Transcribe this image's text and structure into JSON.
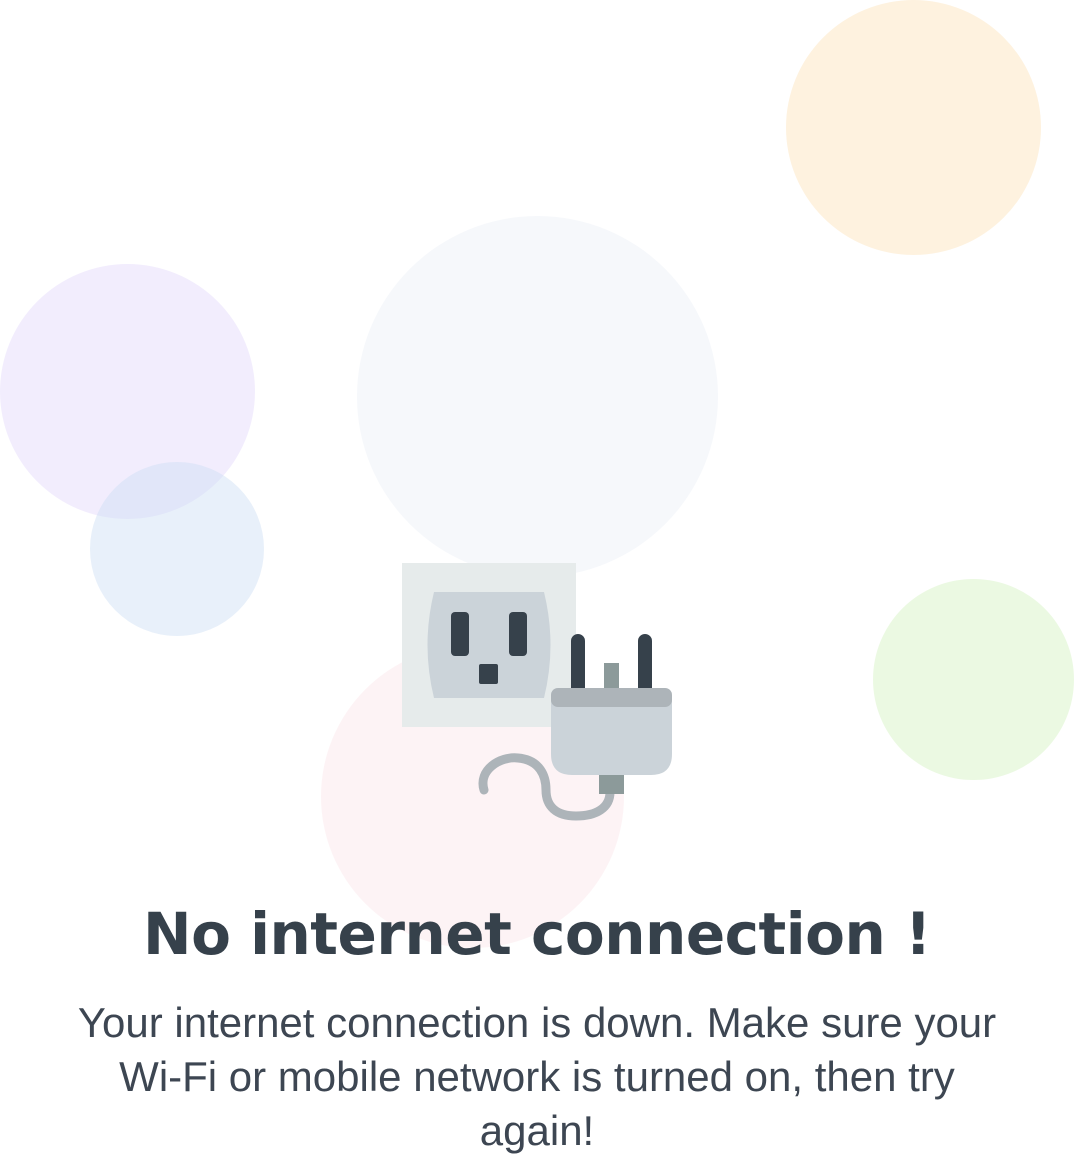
{
  "offline_screen": {
    "title": "No internet connection !",
    "message": "Your internet connection is down. Make sure your Wi-Fi or mobile network is turned on, then try again!"
  },
  "illustration": {
    "icons": [
      "power-outlet-icon",
      "unplugged-plug-icon"
    ]
  },
  "colors": {
    "text_dark": "#36414b",
    "outlet_plate": "#e6ebeb",
    "outlet_face": "#cbd3d9",
    "prong_dark": "#36414b",
    "plug_body": "#cbd3d9",
    "cable": "#adb4b9"
  }
}
